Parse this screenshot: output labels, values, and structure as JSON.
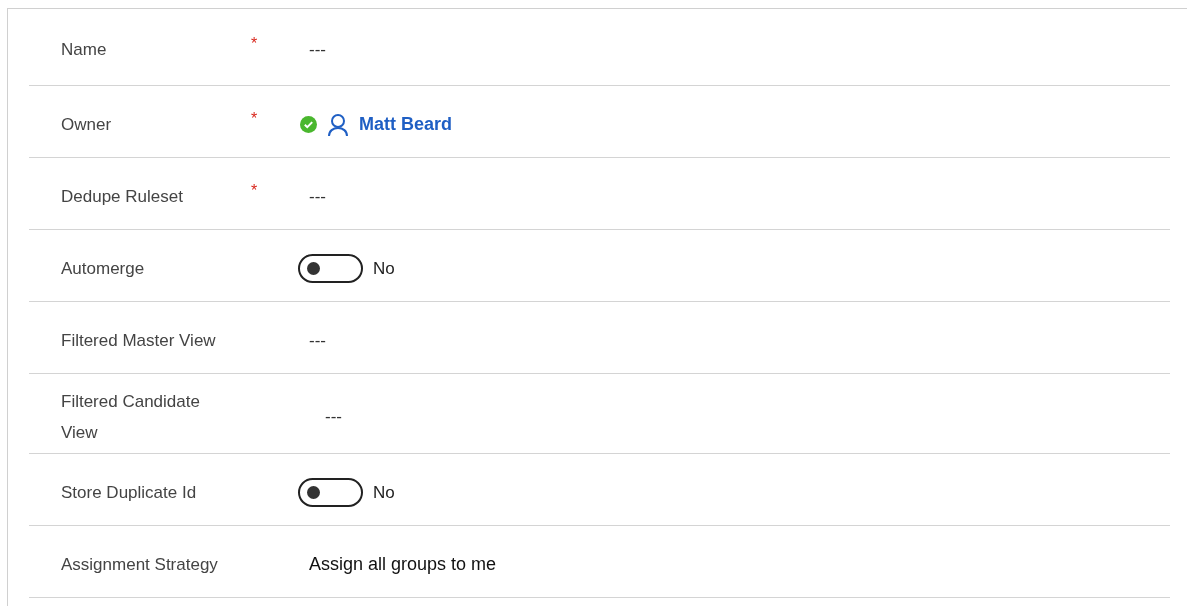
{
  "fields": [
    {
      "label": "Name",
      "required_mark": "*",
      "kind": "text",
      "value": "---"
    },
    {
      "label": "Owner",
      "required_mark": "*",
      "kind": "lookup",
      "value": "Matt Beard"
    },
    {
      "label": "Dedupe Ruleset",
      "required_mark": "*",
      "kind": "text",
      "value": "---"
    },
    {
      "label": "Automerge",
      "kind": "toggle",
      "on": false,
      "value": "No"
    },
    {
      "label": "Filtered Master View",
      "kind": "text",
      "value": "---"
    },
    {
      "label": "Filtered Candidate View",
      "kind": "text",
      "value": "---"
    },
    {
      "label": "Store Duplicate Id",
      "kind": "toggle",
      "on": false,
      "value": "No"
    },
    {
      "label": "Assignment Strategy",
      "kind": "choice",
      "value": "Assign all groups to me"
    }
  ]
}
